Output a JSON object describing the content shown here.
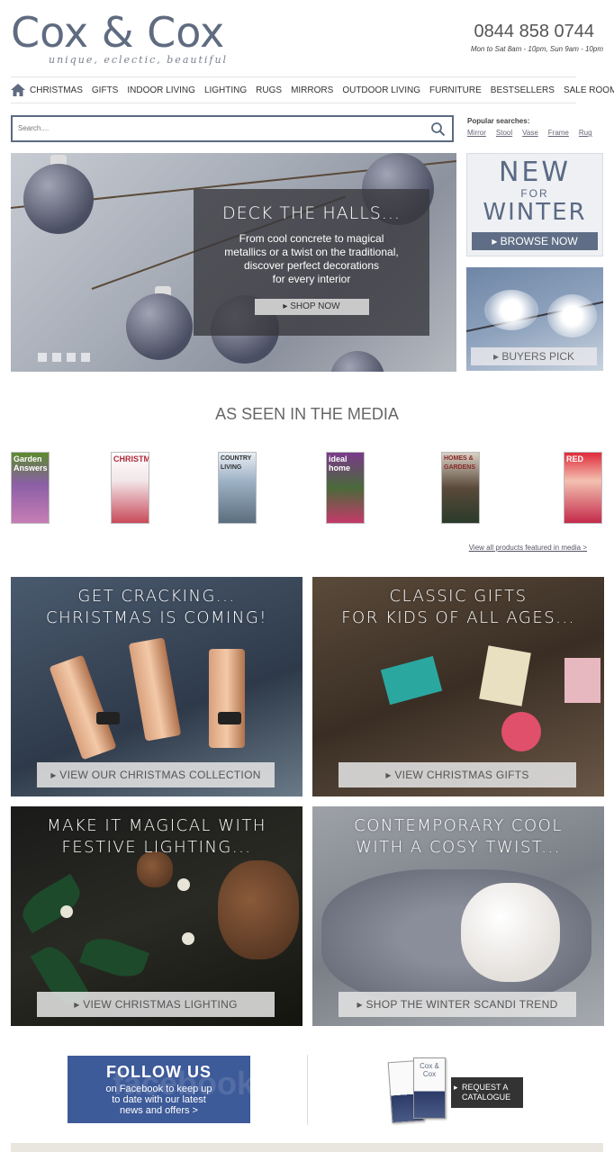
{
  "header": {
    "logo": "Cox & Cox",
    "tagline": "unique, eclectic, beautiful",
    "phone": "0844 858 0744",
    "hours": "Mon to Sat 8am - 10pm, Sun 9am - 10pm"
  },
  "nav": {
    "home_icon": "home-icon",
    "items": [
      "CHRISTMAS",
      "GIFTS",
      "INDOOR LIVING",
      "LIGHTING",
      "RUGS",
      "MIRRORS",
      "OUTDOOR LIVING",
      "FURNITURE",
      "BESTSELLERS",
      "SALE ROOM"
    ]
  },
  "search": {
    "placeholder": "Search....",
    "icon": "search-icon",
    "popular_title": "Popular searches:",
    "popular": [
      "Mirror",
      "Stool",
      "Vase",
      "Frame",
      "Rug"
    ]
  },
  "hero": {
    "title": "DECK THE HALLS...",
    "text_lines": [
      "From cool concrete to magical",
      "metallics or a twist on the traditional,",
      "discover perfect decorations",
      "for every interior"
    ],
    "button": "SHOP NOW"
  },
  "promo_new": {
    "line1": "NEW",
    "line2": "FOR",
    "line3": "WINTER",
    "button": "BROWSE NOW"
  },
  "promo_buyers": {
    "button": "BUYERS PICK"
  },
  "media": {
    "title": "AS SEEN IN THE MEDIA",
    "magazines": [
      "Garden Answers",
      "CHRISTMAS",
      "COUNTRY LIVING",
      "ideal home",
      "HOMES & GARDENS",
      "RED"
    ],
    "view_all": "View all products featured in media >"
  },
  "tiles": [
    {
      "title_1": "GET CRACKING...",
      "title_2": "CHRISTMAS IS COMING!",
      "button": "VIEW OUR CHRISTMAS COLLECTION"
    },
    {
      "title_1": "CLASSIC GIFTS",
      "title_2": "FOR KIDS OF ALL AGES...",
      "button": "VIEW CHRISTMAS GIFTS"
    },
    {
      "title_1": "MAKE IT MAGICAL WITH",
      "title_2": "FESTIVE LIGHTING...",
      "button": "VIEW CHRISTMAS LIGHTING"
    },
    {
      "title_1": "CONTEMPORARY COOL",
      "title_2": "WITH A COSY TWIST...",
      "button": "SHOP THE WINTER SCANDI TREND"
    }
  ],
  "footer": {
    "follow_title": "FOLLOW US",
    "follow_lines": [
      "on Facebook to keep up",
      "to date with our latest",
      "news and offers >"
    ],
    "follow_watermark": "facebook",
    "catalogue_logo": "Cox & Cox",
    "catalogue_lines": [
      "REQUEST A",
      "CATALOGUE"
    ]
  }
}
